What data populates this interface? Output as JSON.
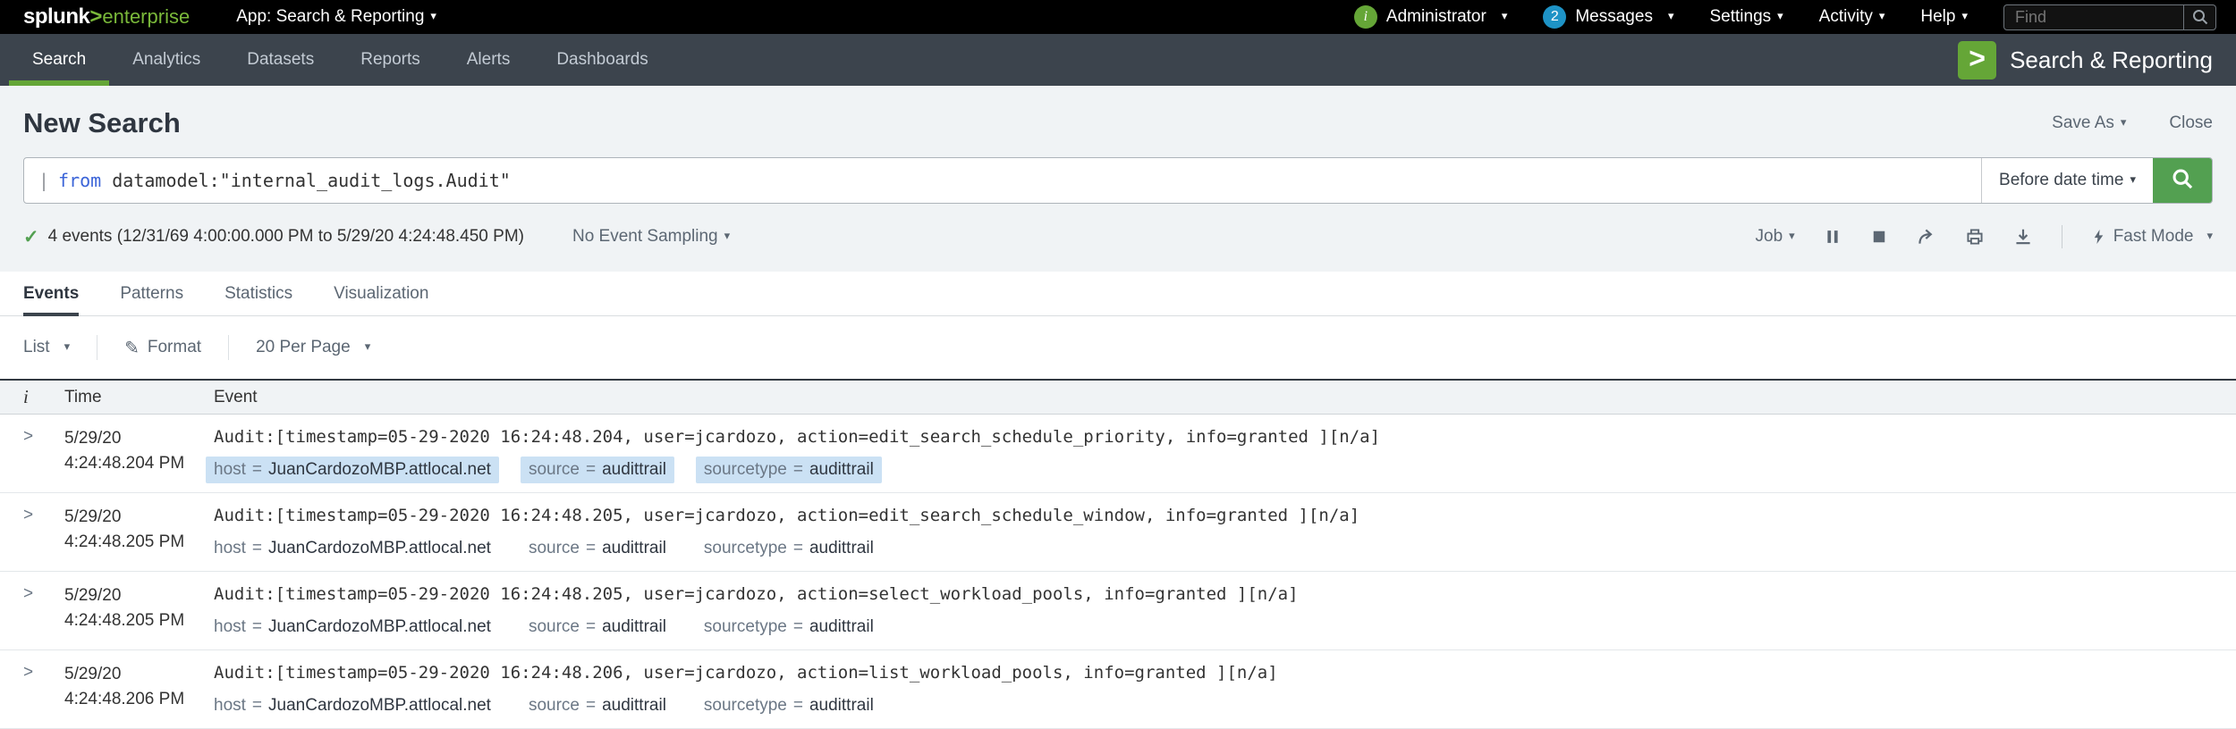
{
  "icons": {
    "caret": "▾",
    "check": "✓",
    "pencil": "✎",
    "health_letter": "i",
    "expand": ">"
  },
  "topbar": {
    "logo": {
      "brand": "splunk",
      "chevron": ">",
      "product": "enterprise"
    },
    "app_menu_label": "App: Search & Reporting",
    "user_label": "Administrator",
    "messages_count": "2",
    "messages_label": "Messages",
    "settings_label": "Settings",
    "activity_label": "Activity",
    "help_label": "Help",
    "find_placeholder": "Find"
  },
  "app_nav": {
    "items": [
      {
        "label": "Search"
      },
      {
        "label": "Analytics"
      },
      {
        "label": "Datasets"
      },
      {
        "label": "Reports"
      },
      {
        "label": "Alerts"
      },
      {
        "label": "Dashboards"
      }
    ],
    "app_icon_glyph": ">",
    "app_title": "Search & Reporting"
  },
  "search_header": {
    "title": "New Search",
    "save_as_label": "Save As",
    "close_label": "Close",
    "query": {
      "pipe": "|",
      "command": "from",
      "rest": " datamodel:\"internal_audit_logs.Audit\""
    },
    "time_range_label": "Before date time"
  },
  "job_bar": {
    "events_summary": "4 events (12/31/69 4:00:00.000 PM to 5/29/20 4:24:48.450 PM)",
    "sampling_label": "No Event Sampling",
    "job_label": "Job",
    "mode_label": "Fast Mode"
  },
  "results_tabs": [
    {
      "label": "Events",
      "active": true
    },
    {
      "label": "Patterns",
      "active": false
    },
    {
      "label": "Statistics",
      "active": false
    },
    {
      "label": "Visualization",
      "active": false
    }
  ],
  "list_controls": {
    "view_label": "List",
    "format_label": "Format",
    "per_page_label": "20 Per Page"
  },
  "events_table": {
    "field_eq": "=",
    "columns": {
      "info": "i",
      "time": "Time",
      "event": "Event"
    },
    "rows": [
      {
        "date": "5/29/20",
        "time": "4:24:48.204 PM",
        "raw": "Audit:[timestamp=05-29-2020 16:24:48.204, user=jcardozo, action=edit_search_schedule_priority, info=granted ][n/a]",
        "highlighted": true,
        "fields": [
          {
            "name": "host",
            "value": "JuanCardozoMBP.attlocal.net"
          },
          {
            "name": "source",
            "value": "audittrail"
          },
          {
            "name": "sourcetype",
            "value": "audittrail"
          }
        ]
      },
      {
        "date": "5/29/20",
        "time": "4:24:48.205 PM",
        "raw": "Audit:[timestamp=05-29-2020 16:24:48.205, user=jcardozo, action=edit_search_schedule_window, info=granted ][n/a]",
        "highlighted": false,
        "fields": [
          {
            "name": "host",
            "value": "JuanCardozoMBP.attlocal.net"
          },
          {
            "name": "source",
            "value": "audittrail"
          },
          {
            "name": "sourcetype",
            "value": "audittrail"
          }
        ]
      },
      {
        "date": "5/29/20",
        "time": "4:24:48.205 PM",
        "raw": "Audit:[timestamp=05-29-2020 16:24:48.205, user=jcardozo, action=select_workload_pools, info=granted ][n/a]",
        "highlighted": false,
        "fields": [
          {
            "name": "host",
            "value": "JuanCardozoMBP.attlocal.net"
          },
          {
            "name": "source",
            "value": "audittrail"
          },
          {
            "name": "sourcetype",
            "value": "audittrail"
          }
        ]
      },
      {
        "date": "5/29/20",
        "time": "4:24:48.206 PM",
        "raw": "Audit:[timestamp=05-29-2020 16:24:48.206, user=jcardozo, action=list_workload_pools, info=granted ][n/a]",
        "highlighted": false,
        "fields": [
          {
            "name": "host",
            "value": "JuanCardozoMBP.attlocal.net"
          },
          {
            "name": "source",
            "value": "audittrail"
          },
          {
            "name": "sourcetype",
            "value": "audittrail"
          }
        ]
      }
    ]
  }
}
